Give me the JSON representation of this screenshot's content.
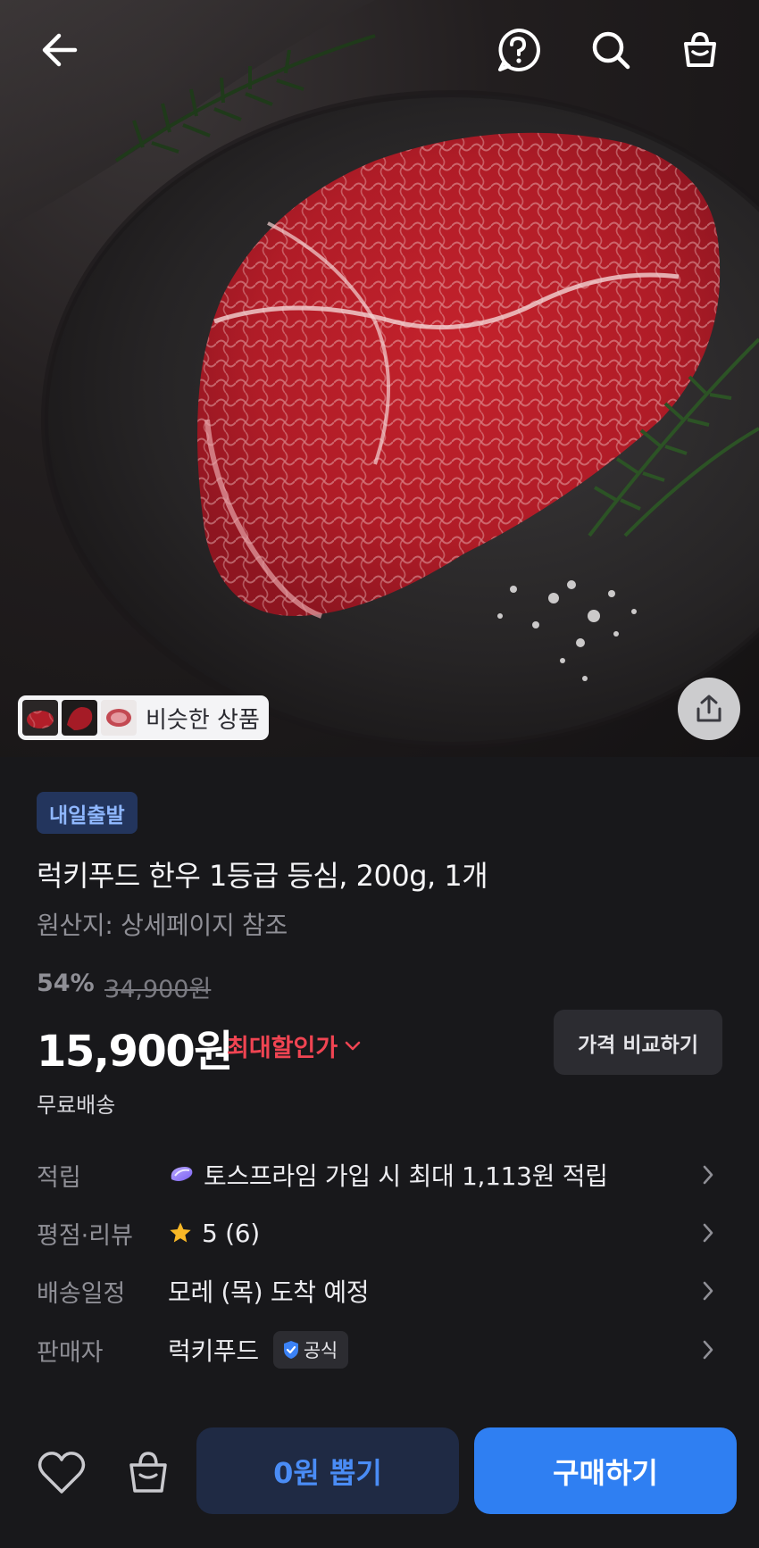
{
  "hero": {
    "similar_label": "비슷한 상품"
  },
  "product": {
    "badge": "내일출발",
    "title": "럭키푸드 한우 1등급 등심, 200g, 1개",
    "origin": "원산지: 상세페이지 참조",
    "discount_rate": "54%",
    "original_price": "34,900원",
    "price": "15,900원",
    "max_discount_label": "최대할인가",
    "compare_button": "가격 비교하기",
    "shipping": "무료배송"
  },
  "details": {
    "points": {
      "label": "적립",
      "value": "토스프라임 가입 시 최대 1,113원 적립"
    },
    "rating": {
      "label": "평점·리뷰",
      "value": "5 (6)"
    },
    "delivery": {
      "label": "배송일정",
      "value": "모레 (목) 도착 예정"
    },
    "seller": {
      "label": "판매자",
      "value": "럭키푸드",
      "official_badge": "공식"
    }
  },
  "bottom_bar": {
    "draw_button": "0원 뽑기",
    "buy_button": "구매하기"
  },
  "colors": {
    "accent_blue": "#2f7ff2",
    "discount_red": "#f04452",
    "badge_text": "#8fb7ff",
    "star": "#f9b826"
  },
  "icons": [
    "back-arrow-icon",
    "help-icon",
    "search-icon",
    "shopping-bag-icon",
    "share-icon",
    "prime-icon",
    "star-icon",
    "chevron-right-icon",
    "verified-icon",
    "heart-icon"
  ]
}
